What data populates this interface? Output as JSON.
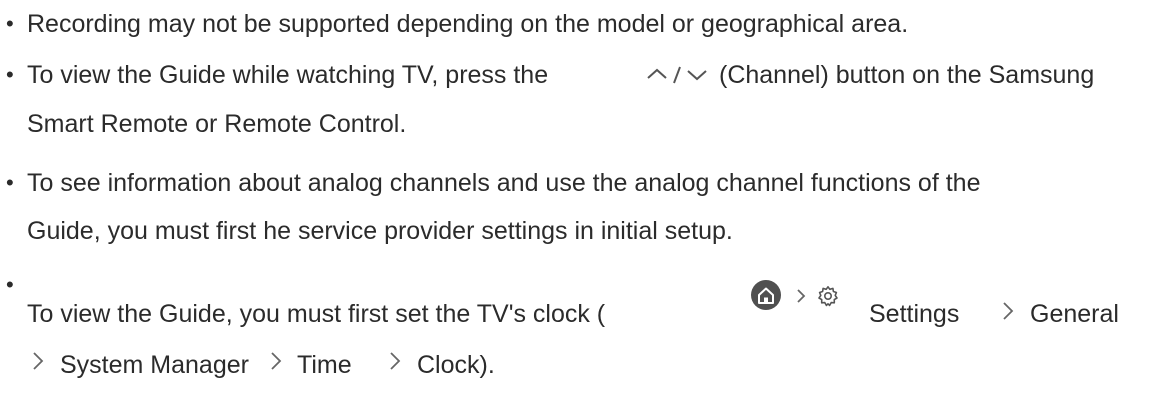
{
  "bullet_char": "•",
  "items": [
    {
      "text": "Recording may not be supported depending on the model or geographical area."
    },
    {
      "text_before": "To view the Guide while watching TV, press the",
      "icon": "channel-up-down-icon",
      "text_after": "(Channel) button on the Samsung",
      "line2": "Smart Remote or Remote Control."
    },
    {
      "line1": "To see information about analog channels and use the analog channel functions of the",
      "line2": "Guide, you must first he service provider settings in initial setup."
    },
    {
      "text_before": "To view the Guide, you must first set the TV's clock (",
      "icons": [
        "home-icon",
        "chevron-right-icon",
        "gear-icon"
      ],
      "path": [
        "Settings",
        "General",
        "System Manager",
        "Time",
        "Clock)."
      ]
    }
  ]
}
